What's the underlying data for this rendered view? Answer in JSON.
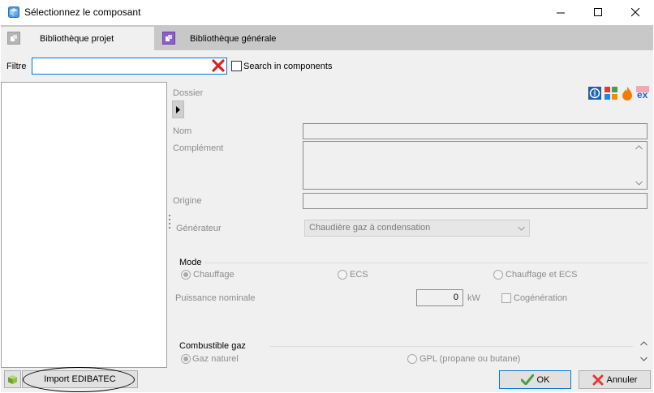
{
  "window": {
    "title": "Sélectionnez le composant"
  },
  "tabs": [
    {
      "label": "Bibliothèque projet"
    },
    {
      "label": "Bibliothèque générale"
    }
  ],
  "filter": {
    "label": "Filtre",
    "value": "",
    "search_in_components_label": "Search in components"
  },
  "form": {
    "dossier_label": "Dossier",
    "nom_label": "Nom",
    "complement_label": "Complément",
    "origine_label": "Origine",
    "generateur_label": "Générateur",
    "generateur_value": "Chaudière gaz à condensation",
    "mode": {
      "label": "Mode",
      "options": [
        "Chauffage",
        "ECS",
        "Chauffage et ECS"
      ]
    },
    "puissance_label": "Puissance nominale",
    "puissance_value": "0",
    "puissance_unit": "kW",
    "cogeneration_label": "Cogénération",
    "combustible": {
      "label": "Combustible gaz",
      "options": [
        "Gaz naturel",
        "GPL (propane ou butane)"
      ]
    },
    "toolbar_icons": [
      "hvac-icon",
      "grid-icon",
      "flame-icon",
      "ex-icon"
    ],
    "toolbar_ex_text": "ex"
  },
  "buttons": {
    "import_label": "Import EDIBATEC",
    "ok_label": "OK",
    "cancel_label": "Annuler"
  },
  "colors": {
    "accent": "#0078d7",
    "ok_green": "#43a047",
    "cancel_red": "#e53935"
  }
}
